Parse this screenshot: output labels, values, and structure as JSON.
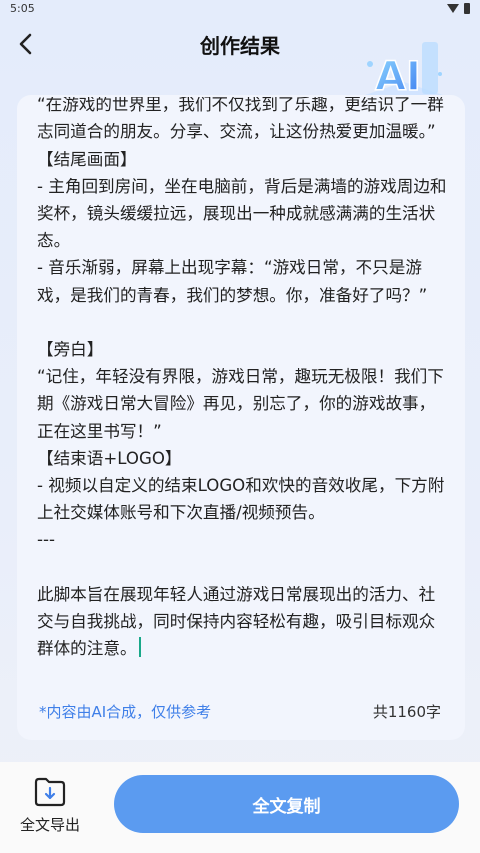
{
  "status_bar": {
    "time": "5:05"
  },
  "header": {
    "title": "创作结果"
  },
  "ai_badge": {
    "text": "AI"
  },
  "content": {
    "text": "【旁白】\n“在游戏的世界里，我们不仅找到了乐趣，更结识了一群志同道合的朋友。分享、交流，让这份热爱更加温暖。”\n【结尾画面】\n- 主角回到房间，坐在电脑前，背后是满墙的游戏周边和奖杯，镜头缓缓拉远，展现出一种成就感满满的生活状态。\n- 音乐渐弱，屏幕上出现字幕：“游戏日常，不只是游戏，是我们的青春，我们的梦想。你，准备好了吗？”\n\n【旁白】\n“记住，年轻没有界限，游戏日常，趣玩无极限！我们下期《游戏日常大冒险》再见，别忘了，你的游戏故事，正在这里书写！”\n【结束语+LOGO】\n- 视频以自定义的结束LOGO和欢快的音效收尾，下方附上社交媒体账号和下次直播/视频预告。\n---\n\n此脚本旨在展现年轻人通过游戏日常展现出的活力、社交与自我挑战，同时保持内容轻松有趣，吸引目标观众群体的注意。",
    "disclaimer": "*内容由AI合成，仅供参考",
    "char_count": "共1160字"
  },
  "bottom_bar": {
    "export_label": "全文导出",
    "copy_label": "全文复制"
  },
  "colors": {
    "accent": "#5b9bf0",
    "disclaimer": "#3f7fe8",
    "cursor": "#1aa889"
  }
}
